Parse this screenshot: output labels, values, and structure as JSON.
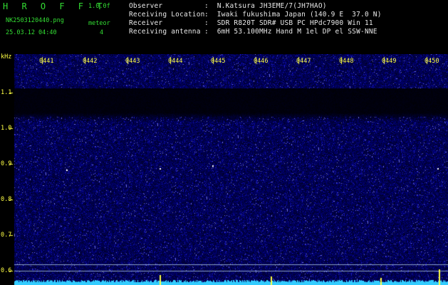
{
  "header": {
    "app_name": "H R O F F T",
    "version": "1.0.0f",
    "filename": "NK2503120440.png",
    "datetime": "25.03.12 04:40",
    "meteor_label": "meteor",
    "meteor_count": "4"
  },
  "info": [
    {
      "label": "Observer",
      "value": ":  N.Katsura JH3EME/7(JH7HAO)"
    },
    {
      "label": "Receiving Location",
      "value": ":  Iwaki fukushima Japan (140.9 E  37.0 N)"
    },
    {
      "label": "Receiver",
      "value": ":  SDR R820T SDR# USB PC HPdc7900 Win 11"
    },
    {
      "label": "Receiving antenna",
      "value": ":  6mH 53.100MHz Hand M 1el DP el SSW-NNE"
    }
  ],
  "axis": {
    "unit": "kHz",
    "y_labels": [
      "1.1",
      "1.0",
      "0.9",
      "0.8",
      "0.7",
      "0.6"
    ],
    "time_labels": [
      "0441",
      "0442",
      "0443",
      "0444",
      "0445",
      "0446",
      "0447",
      "0448",
      "0449",
      "0450"
    ]
  },
  "colors": {
    "background": "#000000",
    "noise_base": "#0c0c6e",
    "header_green": "#33dd33",
    "marker_yellow": "#ffff44",
    "baseline_cyan": "#33ccff"
  }
}
